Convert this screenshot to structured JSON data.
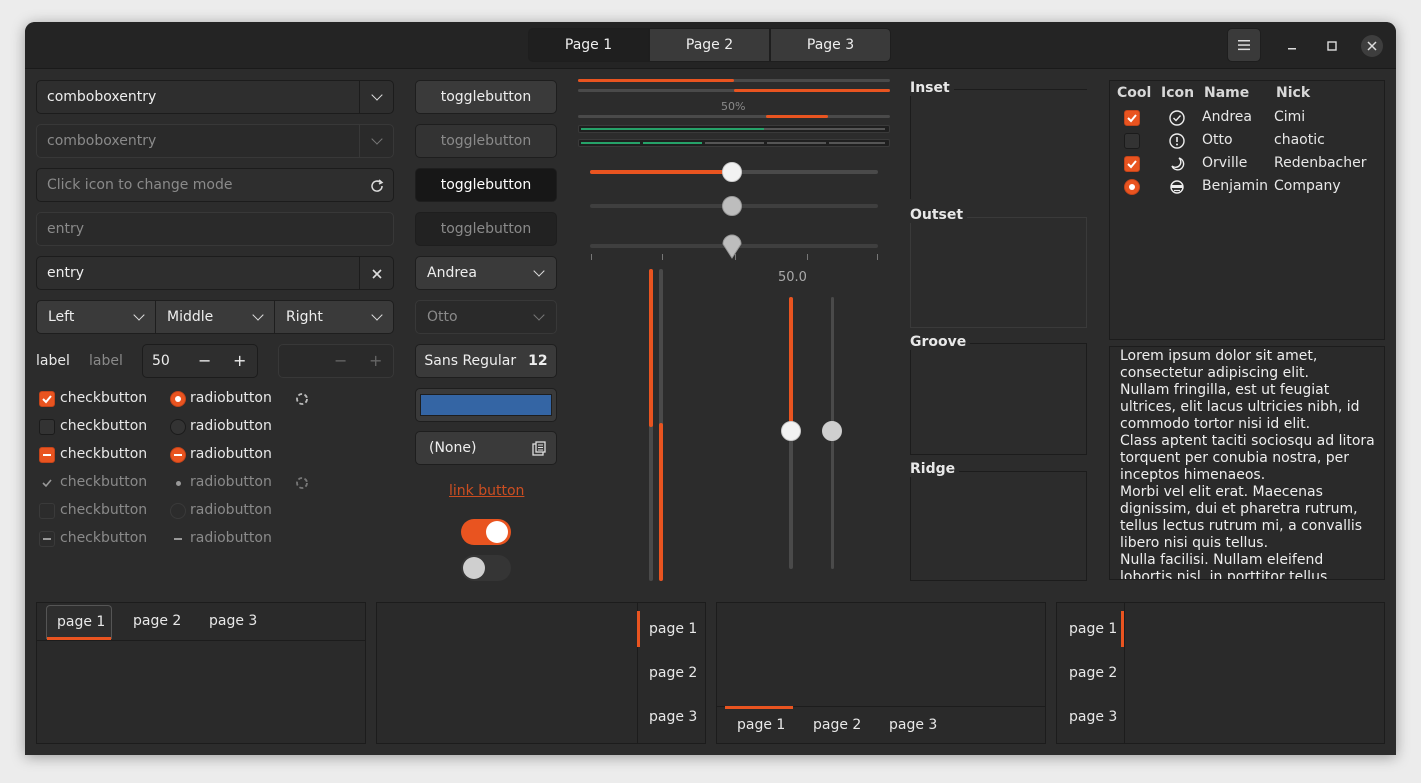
{
  "window": {
    "stack_tabs": [
      "Page 1",
      "Page 2",
      "Page 3"
    ],
    "menu_icon": "hamburger-icon",
    "controls": [
      "minimize",
      "maximize",
      "close"
    ]
  },
  "combos": {
    "combo1": "comboboxentry",
    "combo2": "comboboxentry",
    "mode_placeholder": "Click icon to change mode",
    "entry1": "entry",
    "entry2": "entry"
  },
  "linked": [
    "Left",
    "Middle",
    "Right"
  ],
  "spin": {
    "label1": "label",
    "label2": "label",
    "value": "50",
    "minus": "−",
    "plus": "+"
  },
  "checks": [
    {
      "label": "checkbutton",
      "state": "checked"
    },
    {
      "label": "checkbutton",
      "state": "unchecked"
    },
    {
      "label": "checkbutton",
      "state": "mixed"
    },
    {
      "label": "checkbutton",
      "state": "checked-disabled"
    },
    {
      "label": "checkbutton",
      "state": "unchecked-disabled"
    },
    {
      "label": "checkbutton",
      "state": "mixed-disabled"
    }
  ],
  "radios": [
    {
      "label": "radiobutton",
      "state": "checked"
    },
    {
      "label": "radiobutton",
      "state": "unchecked"
    },
    {
      "label": "radiobutton",
      "state": "mixed"
    },
    {
      "label": "radiobutton",
      "state": "checked-disabled"
    },
    {
      "label": "radiobutton",
      "state": "unchecked-disabled"
    },
    {
      "label": "radiobutton",
      "state": "mixed-disabled"
    }
  ],
  "toggles": [
    "togglebutton",
    "togglebutton",
    "togglebutton",
    "togglebutton"
  ],
  "combo_names": [
    "Andrea",
    "Otto"
  ],
  "font_button": {
    "name": "Sans Regular",
    "size": "12"
  },
  "color_button": "#3465a4",
  "file_button": "(None)",
  "link_button": "link button",
  "switches": [
    true,
    false
  ],
  "progress": {
    "percent_label": "50%",
    "value": 0.5
  },
  "scales": {
    "value_label": "50.0",
    "value": 50
  },
  "frames": [
    "Inset",
    "Outset",
    "Groove",
    "Ridge"
  ],
  "tree": {
    "headers": [
      "Cool",
      "Icon",
      "Name",
      "Nick"
    ],
    "rows": [
      {
        "cool": "checked",
        "icon": "check-circle-icon",
        "name": "Andrea",
        "nick": "Cimi"
      },
      {
        "cool": "unchecked",
        "icon": "exclamation-circle-icon",
        "name": "Otto",
        "nick": "chaotic"
      },
      {
        "cool": "checked",
        "icon": "moon-icon",
        "name": "Orville",
        "nick": "Redenbacher"
      },
      {
        "cool": "radio",
        "icon": "face-icon",
        "name": "Benjamin",
        "nick": "Company"
      }
    ]
  },
  "textview": [
    "Lorem ipsum dolor sit amet,",
    "consectetur adipiscing elit.",
    "Nullam fringilla, est ut feugiat",
    "ultrices, elit lacus ultricies nibh, id",
    "commodo tortor nisi id elit.",
    "Class aptent taciti sociosqu ad litora",
    "torquent per conubia nostra, per",
    "inceptos himenaeos.",
    "Morbi vel elit erat. Maecenas",
    "dignissim, dui et pharetra rutrum,",
    "tellus lectus rutrum mi, a convallis",
    "libero nisi quis tellus.",
    "Nulla facilisi. Nullam eleifend",
    "lobortis nisl, in porttitor tellus"
  ],
  "notebooks": {
    "top": [
      "page 1",
      "page 2",
      "page 3"
    ],
    "right": [
      "page 1",
      "page 2",
      "page 3"
    ],
    "bottom": [
      "page 1",
      "page 2",
      "page 3"
    ],
    "left": [
      "page 1",
      "page 2",
      "page 3"
    ]
  },
  "colors": {
    "accent": "#e95420",
    "bg": "#2c2c2c",
    "headerbar": "#242424",
    "level": "#26a269"
  }
}
